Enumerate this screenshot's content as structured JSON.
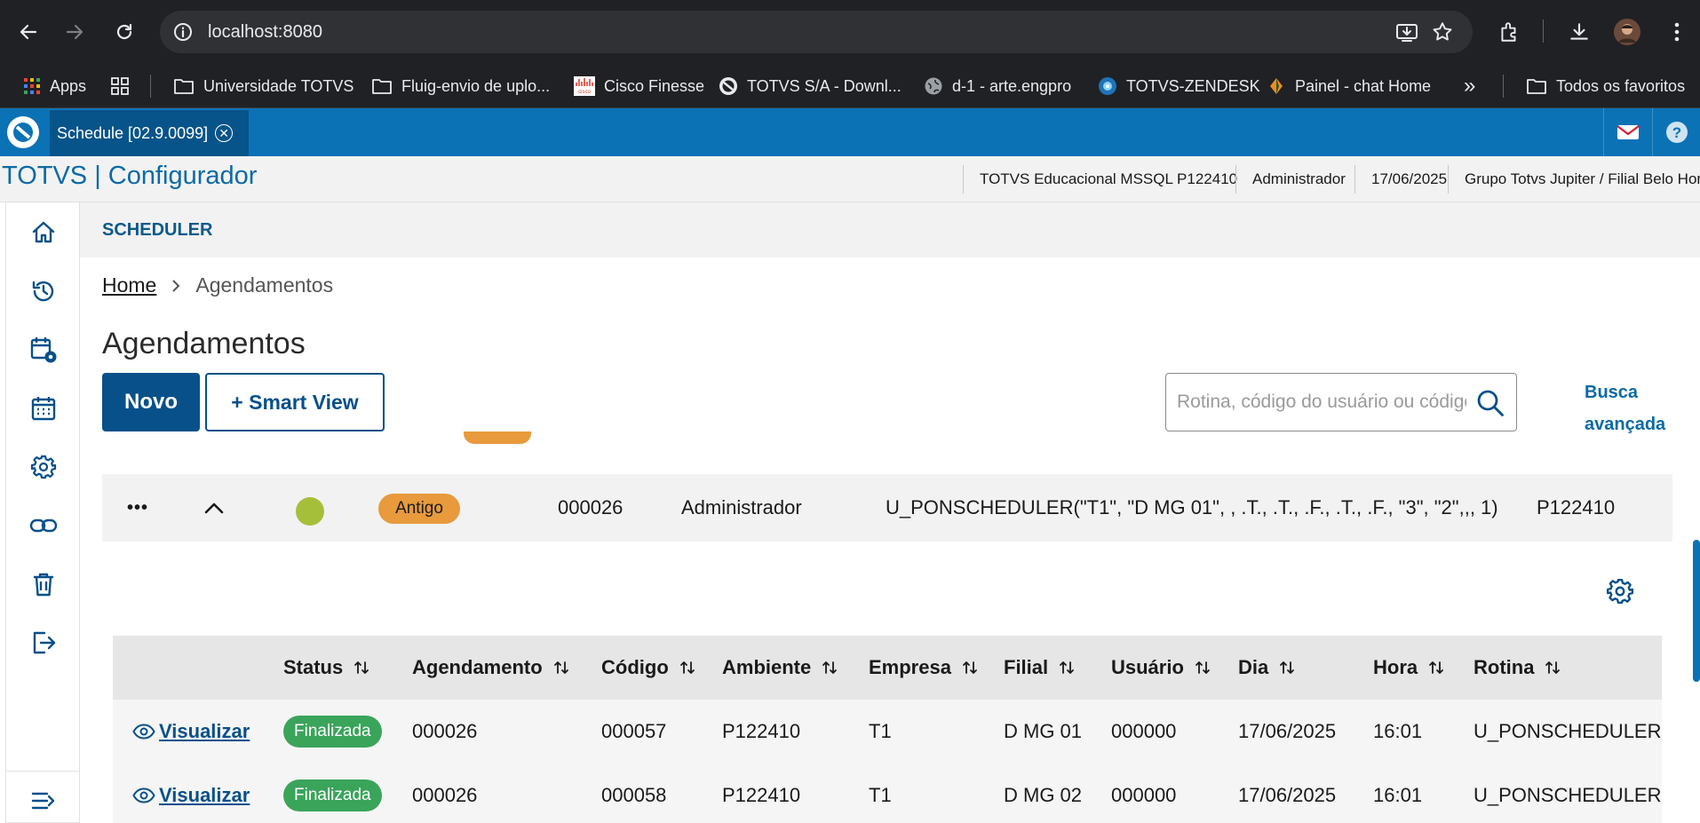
{
  "browser": {
    "url": "localhost:8080",
    "bookmarks": [
      {
        "label": "Apps"
      },
      {
        "label": "Universidade TOTVS"
      },
      {
        "label": "Fluig-envio de uplo..."
      },
      {
        "label": "Cisco Finesse"
      },
      {
        "label": "TOTVS S/A - Downl..."
      },
      {
        "label": "d-1 - arte.engpro"
      },
      {
        "label": "TOTVS-ZENDESK"
      },
      {
        "label": "Painel - chat Home"
      }
    ],
    "all_favorites": "Todos os favoritos",
    "overflow": "»"
  },
  "app_tab": {
    "label": "Schedule [02.9.0099]",
    "close": "✕"
  },
  "header": {
    "title": "TOTVS | Configurador",
    "info": [
      "TOTVS Educacional MSSQL P122410",
      "Administrador",
      "17/06/2025",
      "Grupo Totvs Jupiter / Filial Belo Hor"
    ]
  },
  "sidebar": {
    "items": [
      "home-icon",
      "history-icon",
      "calendar-gear-icon",
      "calendar-icon",
      "settings-icon",
      "link-icon",
      "trash-icon",
      "logout-icon"
    ],
    "collapse": "menu-collapse-icon"
  },
  "main": {
    "section": "SCHEDULER",
    "breadcrumb": {
      "home": "Home",
      "current": "Agendamentos"
    },
    "page_title": "Agendamentos",
    "buttons": {
      "novo": "Novo",
      "smart_view": "+ Smart View"
    },
    "search": {
      "placeholder": "Rotina, código do usuário ou código",
      "advanced": "Busca avançada"
    },
    "group_row": {
      "actions": "•••",
      "status_color": "#a6bf3a",
      "badge": "Antigo",
      "code": "000026",
      "user": "Administrador",
      "routine": "U_PONSCHEDULER(\"T1\", \"D MG 01\", , .T., .T., .F., .T., .F., \"3\", \"2\",,, 1)",
      "env": "P122410"
    },
    "table": {
      "headers": [
        "Status",
        "Agendamento",
        "Código",
        "Ambiente",
        "Empresa",
        "Filial",
        "Usuário",
        "Dia",
        "Hora",
        "Rotina"
      ],
      "rows": [
        {
          "link": "Visualizar",
          "status": "Finalizada",
          "agendamento": "000026",
          "codigo": "000057",
          "ambiente": "P122410",
          "empresa": "T1",
          "filial": "D MG 01",
          "usuario": "000000",
          "dia": "17/06/2025",
          "hora": "16:01",
          "rotina": "U_PONSCHEDULER"
        },
        {
          "link": "Visualizar",
          "status": "Finalizada",
          "agendamento": "000026",
          "codigo": "000058",
          "ambiente": "P122410",
          "empresa": "T1",
          "filial": "D MG 02",
          "usuario": "000000",
          "dia": "17/06/2025",
          "hora": "16:01",
          "rotina": "U_PONSCHEDULER"
        }
      ]
    }
  },
  "colors": {
    "primary": "#07508a",
    "tabbar": "#0b72b5",
    "finalizada": "#3aa45b",
    "antigo": "#e89a3c"
  }
}
